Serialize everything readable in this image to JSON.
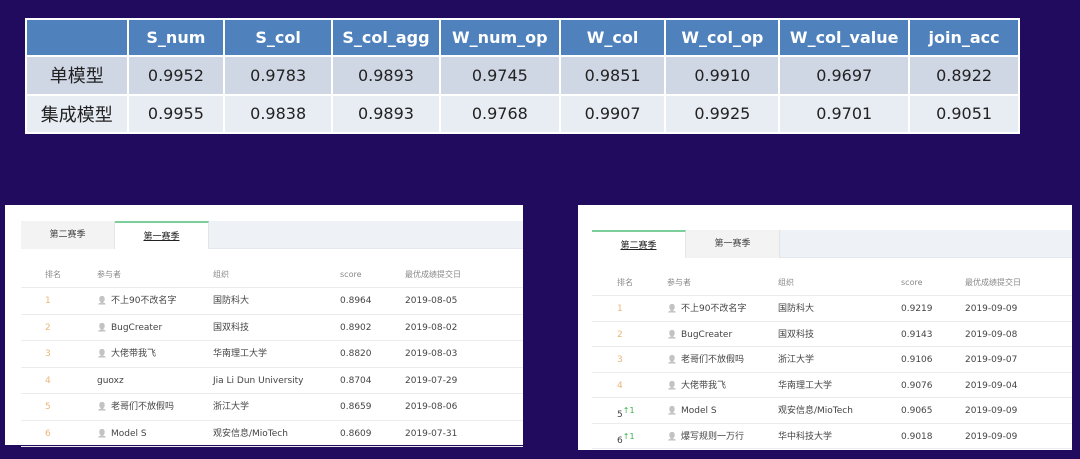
{
  "summary_table": {
    "headers": [
      "",
      "S_num",
      "S_col",
      "S_col_agg",
      "W_num_op",
      "W_col",
      "W_col_op",
      "W_col_value",
      "join_acc"
    ],
    "rows": [
      [
        "单模型",
        "0.9952",
        "0.9783",
        "0.9893",
        "0.9745",
        "0.9851",
        "0.9910",
        "0.9697",
        "0.8922"
      ],
      [
        "集成模型",
        "0.9955",
        "0.9838",
        "0.9893",
        "0.9768",
        "0.9907",
        "0.9925",
        "0.9701",
        "0.9051"
      ]
    ]
  },
  "leaderboard_left": {
    "tabs": [
      "第二赛季",
      "第一赛季"
    ],
    "active_tab": 1,
    "columns": [
      "排名",
      "参与者",
      "组织",
      "score",
      "最优成绩提交日"
    ],
    "rows": [
      {
        "rank": "1",
        "name": "不上90不改名字",
        "org": "国防科大",
        "score": "0.8964",
        "date": "2019-08-05",
        "icon": true
      },
      {
        "rank": "2",
        "name": "BugCreater",
        "org": "国双科技",
        "score": "0.8902",
        "date": "2019-08-02",
        "icon": true
      },
      {
        "rank": "3",
        "name": "大佬带我飞",
        "org": "华南理工大学",
        "score": "0.8820",
        "date": "2019-08-03",
        "icon": true
      },
      {
        "rank": "4",
        "name": "guoxz",
        "org": "Jia Li Dun University",
        "score": "0.8704",
        "date": "2019-07-29",
        "icon": false
      },
      {
        "rank": "5",
        "name": "老哥们不放假吗",
        "org": "浙江大学",
        "score": "0.8659",
        "date": "2019-08-06",
        "icon": true
      },
      {
        "rank": "6",
        "name": "Model S",
        "org": "观安信息/MioTech",
        "score": "0.8609",
        "date": "2019-07-31",
        "icon": true
      }
    ]
  },
  "leaderboard_right": {
    "tabs": [
      "第二赛季",
      "第一赛季"
    ],
    "active_tab": 0,
    "columns": [
      "排名",
      "参与者",
      "组织",
      "score",
      "最优成绩提交日"
    ],
    "rows": [
      {
        "rank": "1",
        "name": "不上90不改名字",
        "org": "国防科大",
        "score": "0.9219",
        "date": "2019-09-09",
        "icon": true
      },
      {
        "rank": "2",
        "name": "BugCreater",
        "org": "国双科技",
        "score": "0.9143",
        "date": "2019-09-08",
        "icon": true
      },
      {
        "rank": "3",
        "name": "老哥们不放假吗",
        "org": "浙江大学",
        "score": "0.9106",
        "date": "2019-09-07",
        "icon": true
      },
      {
        "rank": "4",
        "name": "大佬带我飞",
        "org": "华南理工大学",
        "score": "0.9076",
        "date": "2019-09-04",
        "icon": true
      },
      {
        "rank": "5",
        "change": "↑1",
        "name": "Model S",
        "org": "观安信息/MioTech",
        "score": "0.9065",
        "date": "2019-09-09",
        "icon": true
      },
      {
        "rank": "6",
        "change": "↑1",
        "name": "爆写规则一万行",
        "org": "华中科技大学",
        "score": "0.9018",
        "date": "2019-09-09",
        "icon": true
      }
    ]
  },
  "colors": {
    "background": "#200b5e",
    "header": "#4f81bd",
    "row1": "#cfd6e4",
    "row2": "#e8ecf3",
    "rank": "#e9b77a",
    "up": "#3bb04a"
  }
}
